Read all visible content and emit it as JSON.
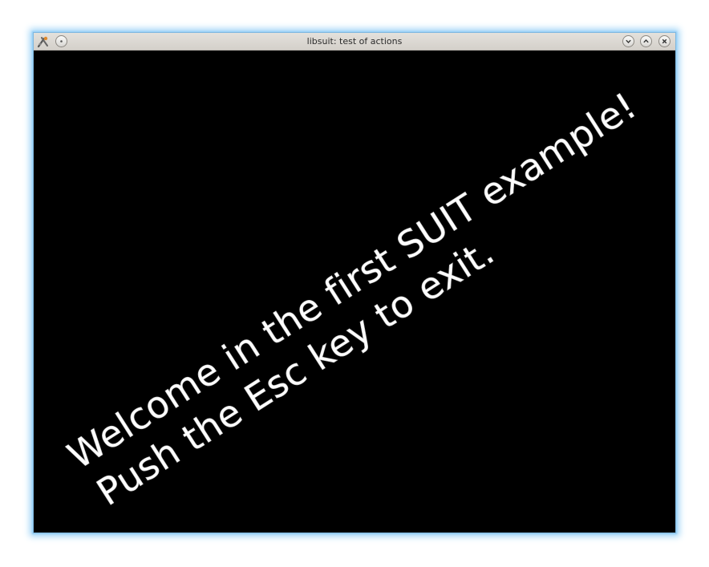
{
  "window": {
    "title": "libsuit: test of actions"
  },
  "titlebar": {
    "app_icon": "xfce-mouse-icon",
    "buttons": {
      "menu": "window-menu-icon",
      "minimize": "chevron-down-icon",
      "maximize": "chevron-up-icon",
      "close": "close-icon"
    }
  },
  "content": {
    "line1": "Welcome in the first SUIT example!",
    "line2": "Push the Esc key to exit.",
    "background_color": "#000000",
    "text_color": "#ffffff"
  }
}
